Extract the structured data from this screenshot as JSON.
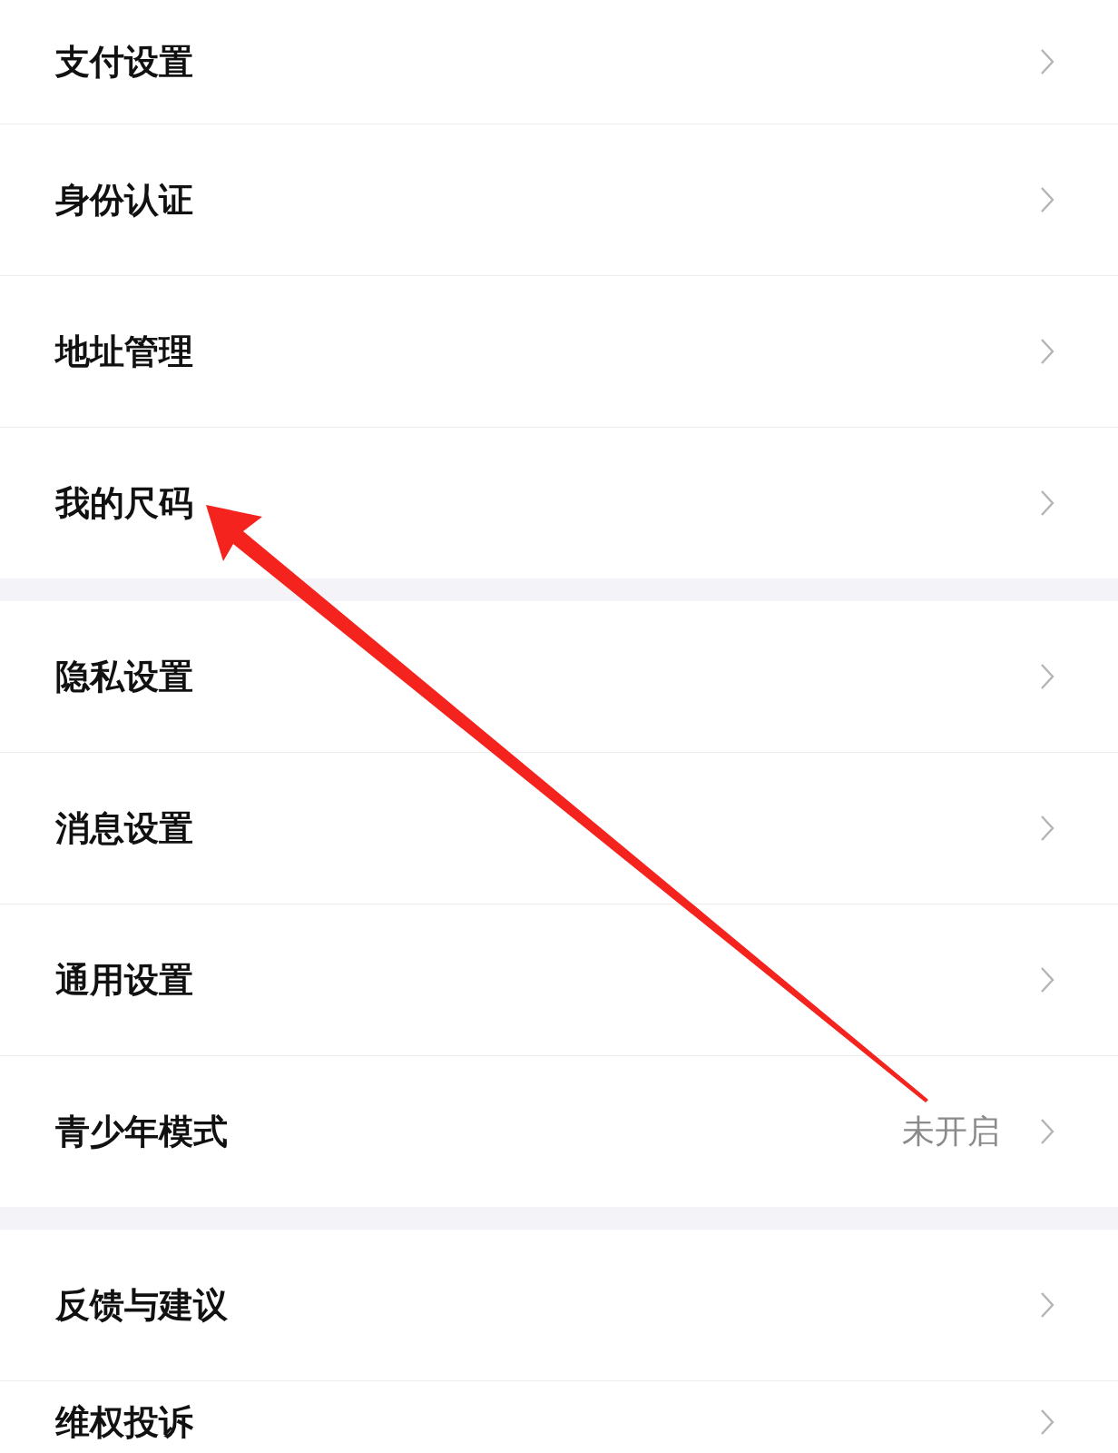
{
  "sections": [
    {
      "items": [
        {
          "label": "支付设置"
        },
        {
          "label": "身份认证"
        },
        {
          "label": "地址管理"
        },
        {
          "label": "我的尺码"
        }
      ]
    },
    {
      "items": [
        {
          "label": "隐私设置"
        },
        {
          "label": "消息设置"
        },
        {
          "label": "通用设置"
        },
        {
          "label": "青少年模式",
          "value": "未开启"
        }
      ]
    },
    {
      "items": [
        {
          "label": "反馈与建议"
        },
        {
          "label": "维权投诉"
        }
      ]
    }
  ]
}
